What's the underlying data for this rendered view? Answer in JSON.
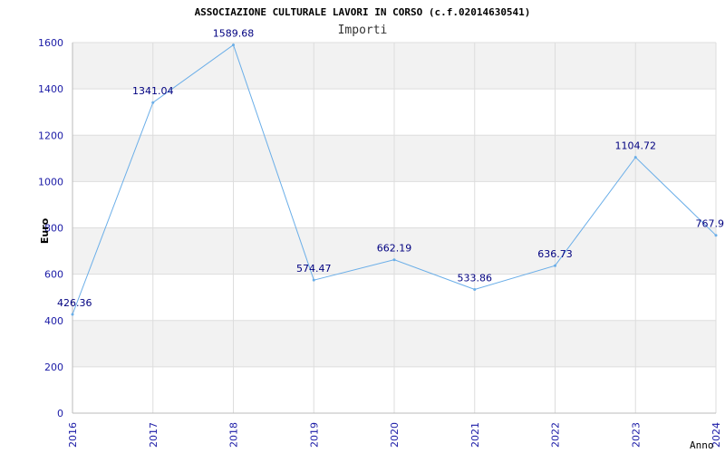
{
  "chart_data": {
    "type": "line",
    "title": "ASSOCIAZIONE CULTURALE LAVORI IN CORSO (c.f.02014630541)",
    "subtitle": "Importi",
    "ylabel": "Euro",
    "xlabel": "Anno",
    "x": [
      "2016",
      "2017",
      "2018",
      "2019",
      "2020",
      "2021",
      "2022",
      "2023",
      "2024"
    ],
    "values": [
      426.36,
      1341.04,
      1589.68,
      574.47,
      662.19,
      533.86,
      636.73,
      1104.72,
      767.9
    ],
    "value_labels": [
      "426.36",
      "1341.04",
      "1589.68",
      "574.47",
      "662.19",
      "533.86",
      "636.73",
      "1104.72",
      "767.9"
    ],
    "ylim": [
      0,
      1600
    ],
    "yticks": [
      0,
      200,
      400,
      600,
      800,
      1000,
      1200,
      1400,
      1600
    ],
    "grid": true,
    "colors": {
      "line": "#6aaee8",
      "band": "#f2f2f2",
      "grid": "#dddddd",
      "tick_text": "#1a1aa6",
      "label_text": "#000080"
    }
  }
}
